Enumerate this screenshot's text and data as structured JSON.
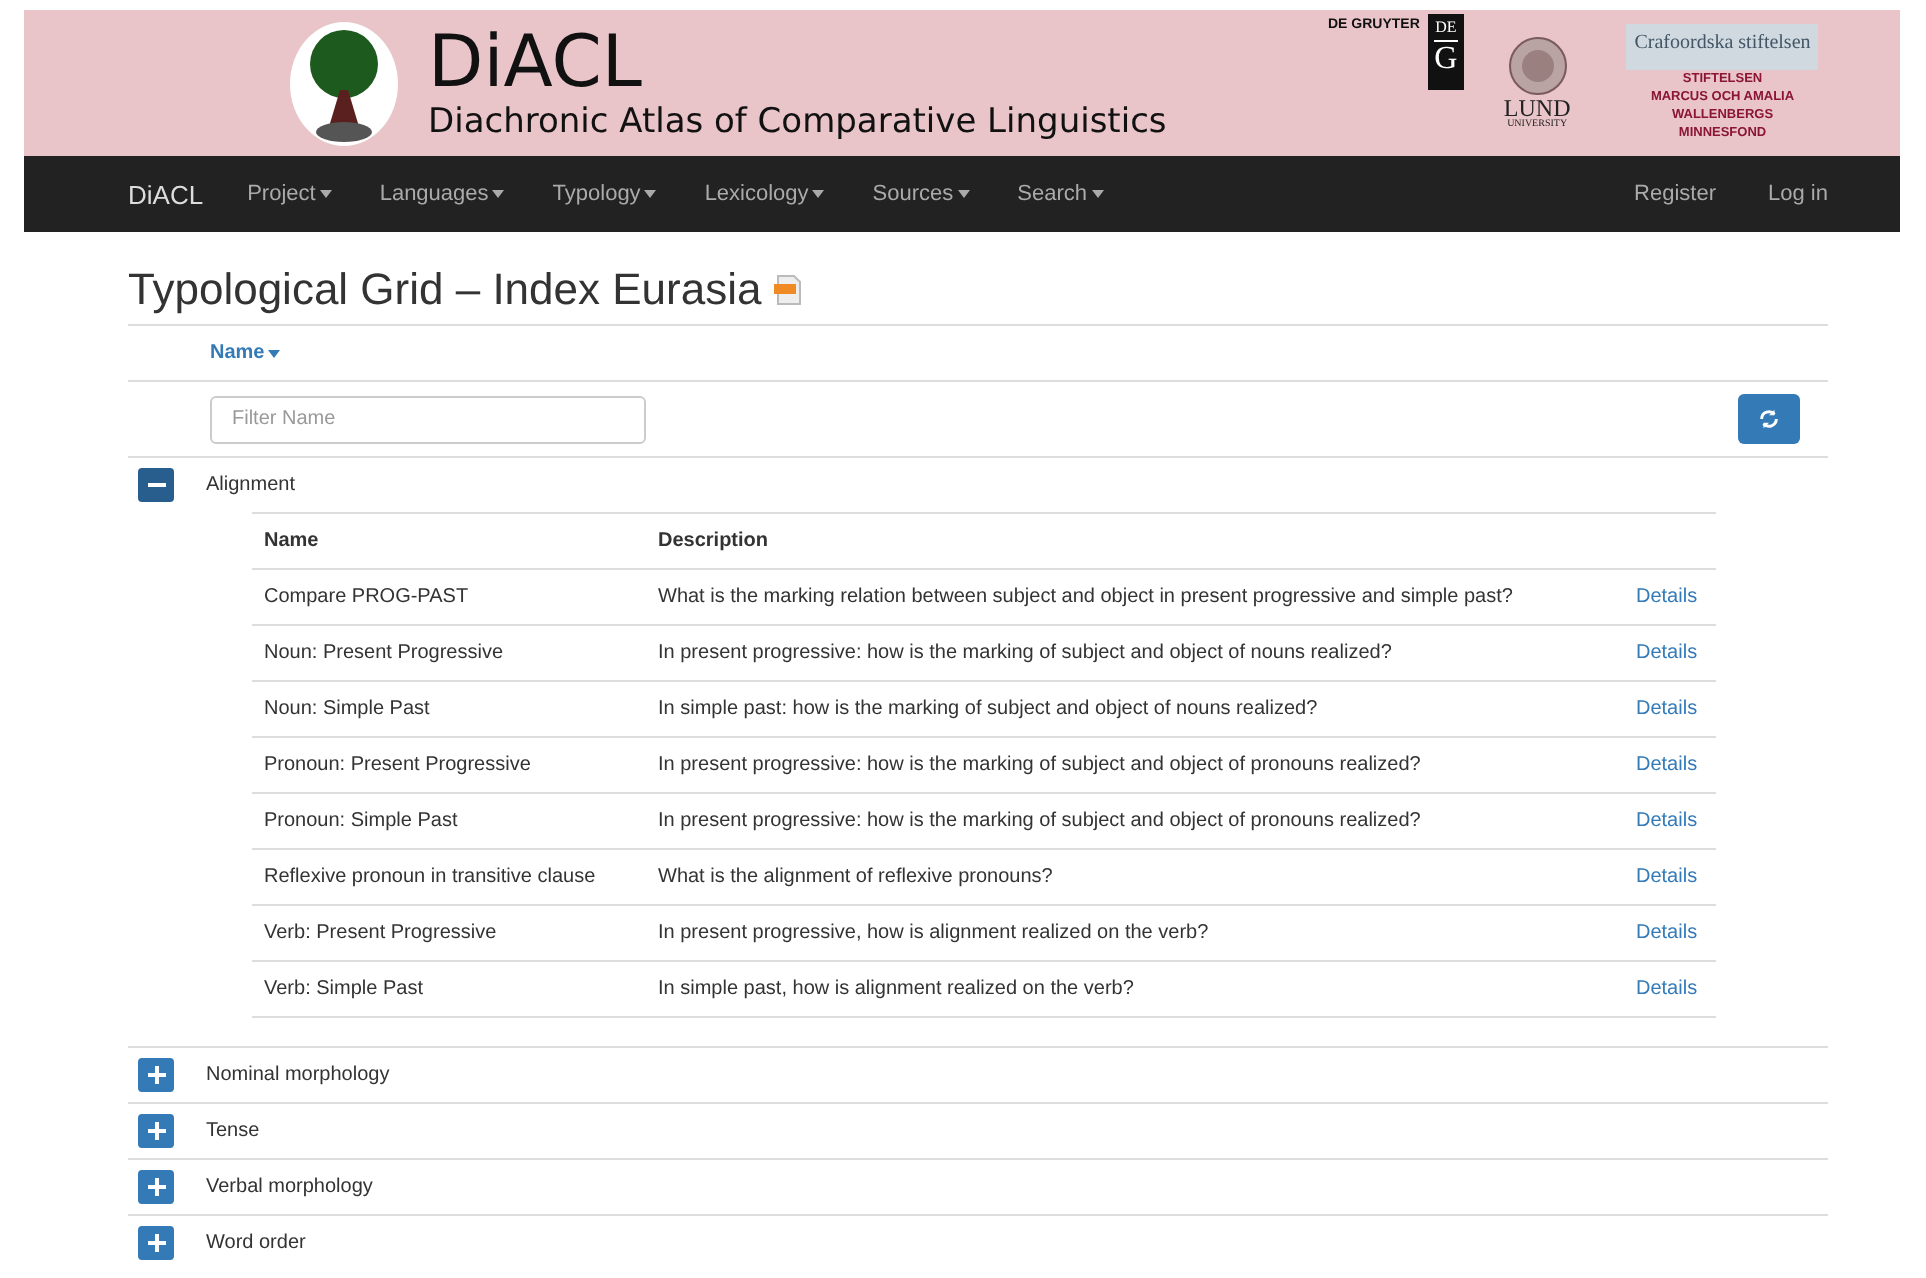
{
  "banner": {
    "title": "DiACL",
    "subtitle": "Diachronic Atlas of Comparative Linguistics",
    "publisher": "DE GRUYTER",
    "publisher_mark": [
      "DE",
      "G"
    ],
    "university": "LUND",
    "university_sub": "UNIVERSITY",
    "foundation": "Crafoordska stiftelsen",
    "foundation_lines": [
      "STIFTELSEN",
      "MARCUS OCH AMALIA",
      "WALLENBERGS",
      "MINNESFOND"
    ]
  },
  "nav": {
    "brand": "DiACL",
    "menus": [
      "Project",
      "Languages",
      "Typology",
      "Lexicology",
      "Sources",
      "Search"
    ],
    "right": [
      "Register",
      "Log in"
    ]
  },
  "page_title": "Typological Grid – Index Eurasia",
  "sort_header": "Name",
  "filter": {
    "placeholder": "Filter Name"
  },
  "groups": [
    {
      "name": "Alignment",
      "expanded": true,
      "columns": [
        "Name",
        "Description"
      ],
      "rows": [
        {
          "name": "Compare PROG-PAST",
          "description": "What is the marking relation between subject and object in present progressive and simple past?",
          "link": "Details"
        },
        {
          "name": "Noun: Present Progressive",
          "description": "In present progressive: how is the marking of subject and object of nouns realized?",
          "link": "Details"
        },
        {
          "name": "Noun: Simple Past",
          "description": "In simple past: how is the marking of subject and object of nouns realized?",
          "link": "Details"
        },
        {
          "name": "Pronoun: Present Progressive",
          "description": "In present progressive: how is the marking of subject and object of pronouns realized?",
          "link": "Details"
        },
        {
          "name": "Pronoun: Simple Past",
          "description": "In present progressive: how is the marking of subject and object of pronouns realized?",
          "link": "Details"
        },
        {
          "name": "Reflexive pronoun in transitive clause",
          "description": "What is the alignment of reflexive pronouns?",
          "link": "Details"
        },
        {
          "name": "Verb: Present Progressive",
          "description": "In present progressive, how is alignment realized on the verb?",
          "link": "Details"
        },
        {
          "name": "Verb: Simple Past",
          "description": "In simple past, how is alignment realized on the verb?",
          "link": "Details"
        }
      ]
    },
    {
      "name": "Nominal morphology",
      "expanded": false
    },
    {
      "name": "Tense",
      "expanded": false
    },
    {
      "name": "Verbal morphology",
      "expanded": false
    },
    {
      "name": "Word order",
      "expanded": false
    }
  ]
}
